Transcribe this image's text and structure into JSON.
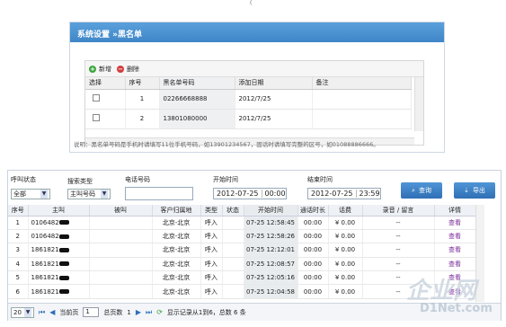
{
  "top_mark": "(",
  "blacklist": {
    "title": "系统设置 »黑名单",
    "add_label": "新增",
    "delete_label": "删除",
    "columns": [
      "选择",
      "序号",
      "黑名单号码",
      "添加日期",
      "备注"
    ],
    "rows": [
      {
        "index": "1",
        "number": "02266668888",
        "date": "2012/7/25",
        "note": ""
      },
      {
        "index": "2",
        "number": "13801080000",
        "date": "2012/7/25",
        "note": ""
      }
    ],
    "note": "说明：黑名单号码是手机时请填写11位手机号码，如13901234567，固话时请填写完整的区号，如01088886666。"
  },
  "search": {
    "call_status_label": "呼叫状态",
    "call_status_value": "全部",
    "search_type_label": "搜索类型",
    "search_type_value": "主叫号码",
    "phone_label": "电话号码",
    "phone_value": "",
    "start_label": "开始时间",
    "start_date": "2012-07-25",
    "start_time": "00:00",
    "end_label": "结束时间",
    "end_date": "2012-07-25",
    "end_time": "23:59",
    "query_label": "查询",
    "export_label": "导出"
  },
  "records": {
    "columns": [
      "序号",
      "主叫",
      "被叫",
      "客户归属地",
      "类型",
      "状态",
      "开始时间",
      "通话时长",
      "话费",
      "录音 / 留言",
      "详情"
    ],
    "rows": [
      {
        "no": "1",
        "caller": "0106482",
        "callee": "",
        "location": "北京-北京",
        "type": "呼入",
        "status": "",
        "start": "07-25 12:58:45",
        "duration": "00:00",
        "fee": "¥ 0.00",
        "recording": "--",
        "detail": "查看"
      },
      {
        "no": "2",
        "caller": "0106482",
        "callee": "",
        "location": "北京-北京",
        "type": "呼入",
        "status": "",
        "start": "07-25 12:58:26",
        "duration": "00:00",
        "fee": "¥ 0.00",
        "recording": "--",
        "detail": "查看"
      },
      {
        "no": "3",
        "caller": "1861821",
        "callee": "",
        "location": "北京-北京",
        "type": "呼入",
        "status": "",
        "start": "07-25 12:12:01",
        "duration": "00:00",
        "fee": "¥ 0.00",
        "recording": "--",
        "detail": "查看"
      },
      {
        "no": "4",
        "caller": "1861821",
        "callee": "",
        "location": "北京-北京",
        "type": "呼入",
        "status": "",
        "start": "07-25 12:08:57",
        "duration": "00:00",
        "fee": "¥ 0.00",
        "recording": "--",
        "detail": "查看"
      },
      {
        "no": "5",
        "caller": "1861821",
        "callee": "",
        "location": "北京-北京",
        "type": "呼入",
        "status": "",
        "start": "07-25 12:05:16",
        "duration": "00:00",
        "fee": "¥ 0.00",
        "recording": "--",
        "detail": "查看"
      },
      {
        "no": "6",
        "caller": "1861821",
        "callee": "",
        "location": "北京-北京",
        "type": "呼入",
        "status": "",
        "start": "07-25 12:04:58",
        "duration": "00:00",
        "fee": "¥ 0.00",
        "recording": "--",
        "detail": "查看"
      }
    ],
    "pager": {
      "page_size": "20",
      "current_prefix": "当前页",
      "current_page": "1",
      "total_prefix": "总页数",
      "total_pages": "1",
      "info": "显示记录从1到6，总数 6 条"
    }
  },
  "watermark": {
    "brand": "企业网",
    "domain": "D1Net.com"
  }
}
